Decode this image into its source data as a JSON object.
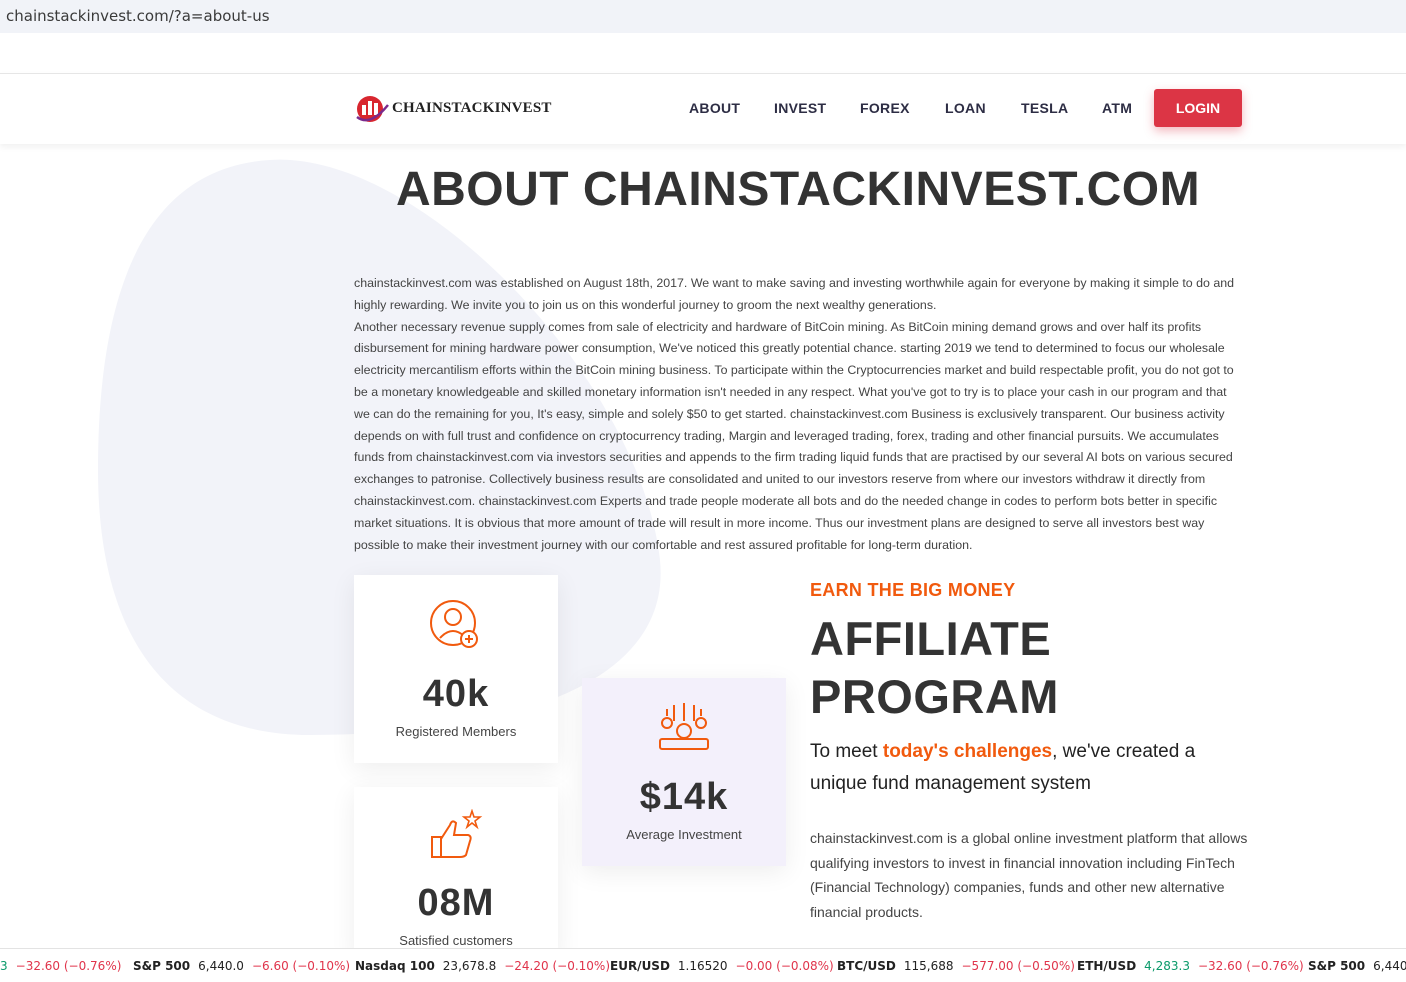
{
  "browser": {
    "url": "chainstackinvest.com/?a=about-us"
  },
  "nav": {
    "logo_text": "CHAINSTACKINVEST",
    "menu": [
      "ABOUT",
      "INVEST",
      "FOREX",
      "LOAN",
      "TESLA",
      "ATM"
    ],
    "login": "LOGIN"
  },
  "page": {
    "title": "ABOUT CHAINSTACKINVEST.COM",
    "para1": "chainstackinvest.com was established on August 18th, 2017. We want to make saving and investing worthwhile again for everyone by making it simple to do and highly rewarding. We invite you to join us on this wonderful journey to groom the next wealthy generations.",
    "para2": "Another necessary revenue supply comes from sale of electricity and hardware of BitCoin mining. As BitCoin mining demand grows and over half its profits disbursement for mining hardware power consumption, We've noticed this greatly potential chance. starting 2019 we tend to determined to focus our wholesale electricity mercantilism efforts within the BitCoin mining business. To participate within the Cryptocurrencies market and build respectable profit, you do not got to be a monetary knowledgeable and skilled monetary information isn't needed in any respect. What you've got to try is to place your cash in our program and that we can do the remaining for you, It's easy, simple and solely $50 to get started. chainstackinvest.com Business is exclusively transparent. Our business activity depends on with full trust and confidence on cryptocurrency trading, Margin and leveraged trading, forex, trading and other financial pursuits. We accumulates funds from chainstackinvest.com via investors securities and appends to the firm trading liquid funds that are practised by our several AI bots on various secured exchanges to patronise. Collectively business results are consolidated and united to our investors reserve from where our investors withdraw it directly from chainstackinvest.com. chainstackinvest.com Experts and trade people moderate all bots and do the needed change in codes to perform bots better in specific market situations. It is obvious that more amount of trade will result in more income. Thus our investment plans are designed to serve all investors best way possible to make their investment journey with our comfortable and rest assured profitable for long-term duration."
  },
  "stats": [
    {
      "value": "40k",
      "label": "Registered Members",
      "icon": "user-add-icon"
    },
    {
      "value": "$14k",
      "label": "Average Investment",
      "icon": "money-icon"
    },
    {
      "value": "08M",
      "label": "Satisfied customers",
      "icon": "thumbs-up-star-icon"
    }
  ],
  "affiliate": {
    "kicker": "EARN THE BIG MONEY",
    "heading_line1": "AFFILIATE",
    "heading_line2": "PROGRAM",
    "tagline_pre": "To meet ",
    "tagline_hl": "today's challenges",
    "tagline_post": ", we've created a unique fund management system",
    "description": "chainstackinvest.com is a global online investment platform that allows qualifying investors to invest in financial innovation including FinTech (Financial Technology) companies, funds and other new alternative financial products."
  },
  "ticker": [
    {
      "sym": "",
      "price": "3",
      "chg": "−32.60 (−0.76%)",
      "up": false
    },
    {
      "sym": "S&P 500",
      "price": "6,440.0",
      "chg": "−6.60 (−0.10%)",
      "up": false
    },
    {
      "sym": "Nasdaq 100",
      "price": "23,678.8",
      "chg": "−24.20 (−0.10%)",
      "up": false
    },
    {
      "sym": "EUR/USD",
      "price": "1.16520",
      "chg": "−0.00 (−0.08%)",
      "up": false
    },
    {
      "sym": "BTC/USD",
      "price": "115,688",
      "chg": "−577.00 (−0.50%)",
      "up": false
    },
    {
      "sym": "ETH/USD",
      "price": "4,283.3",
      "chg": "−32.60 (−0.76%)",
      "up": false,
      "price_up": true
    },
    {
      "sym": "S&P 500",
      "price": "6,440.0",
      "chg": "",
      "up": false
    }
  ],
  "colors": {
    "accent": "#f15a0e",
    "login": "#dc3545",
    "text": "#333333"
  }
}
